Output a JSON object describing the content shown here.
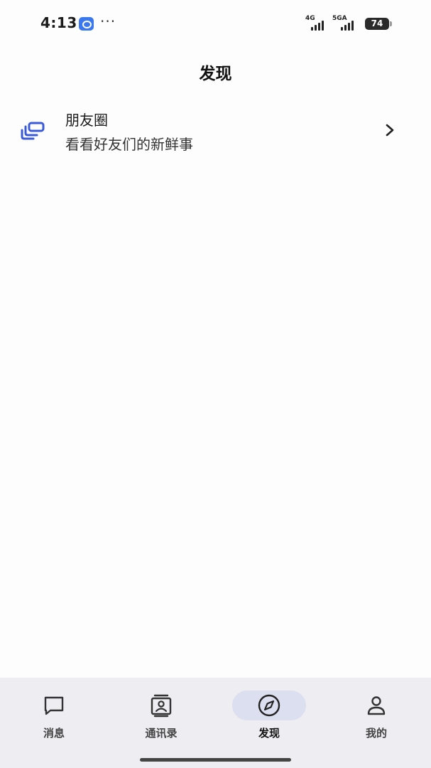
{
  "status_bar": {
    "time": "4:13",
    "more": "···",
    "signal_1_tag": "4G",
    "signal_2_tag": "5GA",
    "battery": "74"
  },
  "page": {
    "title": "发现"
  },
  "moments": {
    "title": "朋友圈",
    "subtitle": "看看好友们的新鲜事",
    "icon": "moments-stack-icon"
  },
  "tab_bar": {
    "tabs": [
      {
        "label": "消息",
        "icon": "chat-bubble-icon",
        "active": false
      },
      {
        "label": "通讯录",
        "icon": "contacts-icon",
        "active": false
      },
      {
        "label": "发现",
        "icon": "compass-icon",
        "active": true
      },
      {
        "label": "我的",
        "icon": "person-icon",
        "active": false
      }
    ]
  },
  "colors": {
    "accent": "#3a5bd9",
    "active_pill": "#dcdff0",
    "tab_bar_bg": "#eeedf2"
  }
}
